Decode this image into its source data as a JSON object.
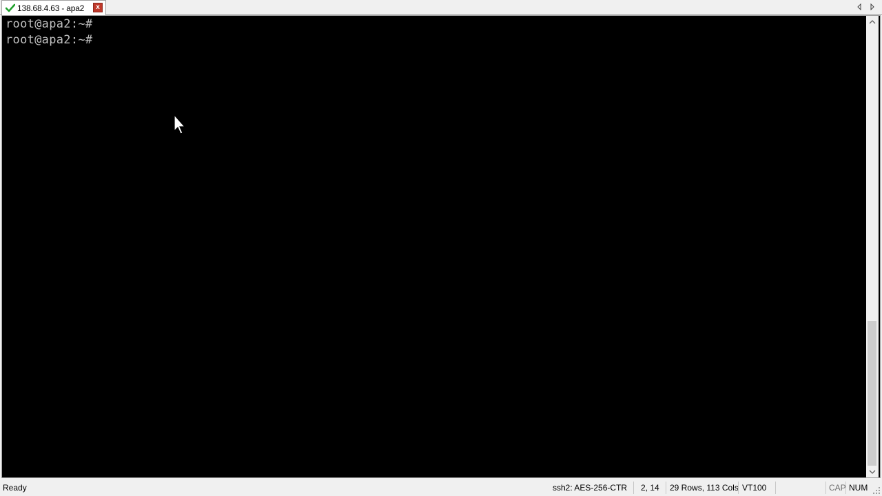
{
  "tab": {
    "title": "138.68.4.63 - apa2",
    "close_label": "x",
    "connected_icon": "checkmark-icon"
  },
  "terminal": {
    "lines": [
      "root@apa2:~#",
      "root@apa2:~#"
    ],
    "background": "#000000",
    "foreground": "#c0c0c0"
  },
  "scrollbar": {
    "thumb_start_fraction": 0.67,
    "thumb_end_fraction": 1.0
  },
  "statusbar": {
    "ready": "Ready",
    "cipher": "ssh2: AES-256-CTR",
    "cursor_pos": "2,  14",
    "dimensions": "29 Rows, 113 Cols",
    "terminal_type": "VT100",
    "caps": "CAP",
    "num": "NUM"
  },
  "colors": {
    "tab_close_bg": "#c0392b",
    "check_green": "#1fa02c"
  }
}
